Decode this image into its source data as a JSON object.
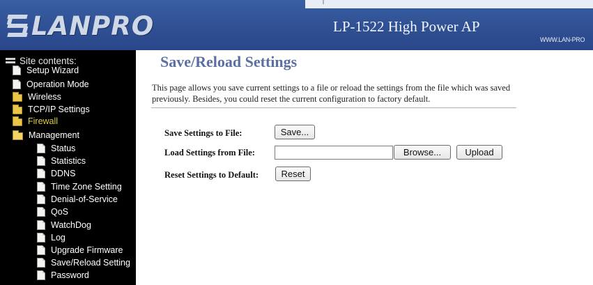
{
  "header": {
    "brand": "LANPRO",
    "model": "LP-1522 High Power AP",
    "website": "WWW.LAN-PRO"
  },
  "sidebar": {
    "root_label": "Site contents:",
    "items": [
      {
        "label": "Setup Wizard",
        "icon": "page-icon"
      },
      {
        "label": "Operation Mode",
        "icon": "page-icon"
      },
      {
        "label": "Wireless",
        "icon": "folder-icon"
      },
      {
        "label": "TCP/IP Settings",
        "icon": "folder-icon"
      },
      {
        "label": "Firewall",
        "icon": "folder-icon"
      },
      {
        "label": "Management",
        "icon": "folder-open-icon"
      },
      {
        "label": "Status",
        "icon": "page-icon"
      },
      {
        "label": "Statistics",
        "icon": "page-icon"
      },
      {
        "label": "DDNS",
        "icon": "page-icon"
      },
      {
        "label": "Time Zone Setting",
        "icon": "page-icon"
      },
      {
        "label": "Denial-of-Service",
        "icon": "page-icon"
      },
      {
        "label": "QoS",
        "icon": "page-icon"
      },
      {
        "label": "WatchDog",
        "icon": "page-icon"
      },
      {
        "label": "Log",
        "icon": "page-icon"
      },
      {
        "label": "Upgrade Firmware",
        "icon": "page-icon"
      },
      {
        "label": "Save/Reload Setting",
        "icon": "page-icon"
      },
      {
        "label": "Password",
        "icon": "page-icon"
      }
    ]
  },
  "main": {
    "title": "Save/Reload Settings",
    "description": "This page allows you save current settings to a file or reload the settings from the file which was saved previously. Besides, you could reset the current configuration to factory default.",
    "save_label": "Save Settings to File:",
    "save_button": "Save...",
    "load_label": "Load Settings from File:",
    "file_value": "",
    "browse_button": "Browse...",
    "upload_button": "Upload",
    "reset_label": "Reset Settings to Default:",
    "reset_button": "Reset"
  },
  "colors": {
    "header_bg": "#2f5093",
    "title": "#5b6fa1",
    "sidebar_bg": "#000000",
    "dim_item": "#d8cc3f"
  }
}
